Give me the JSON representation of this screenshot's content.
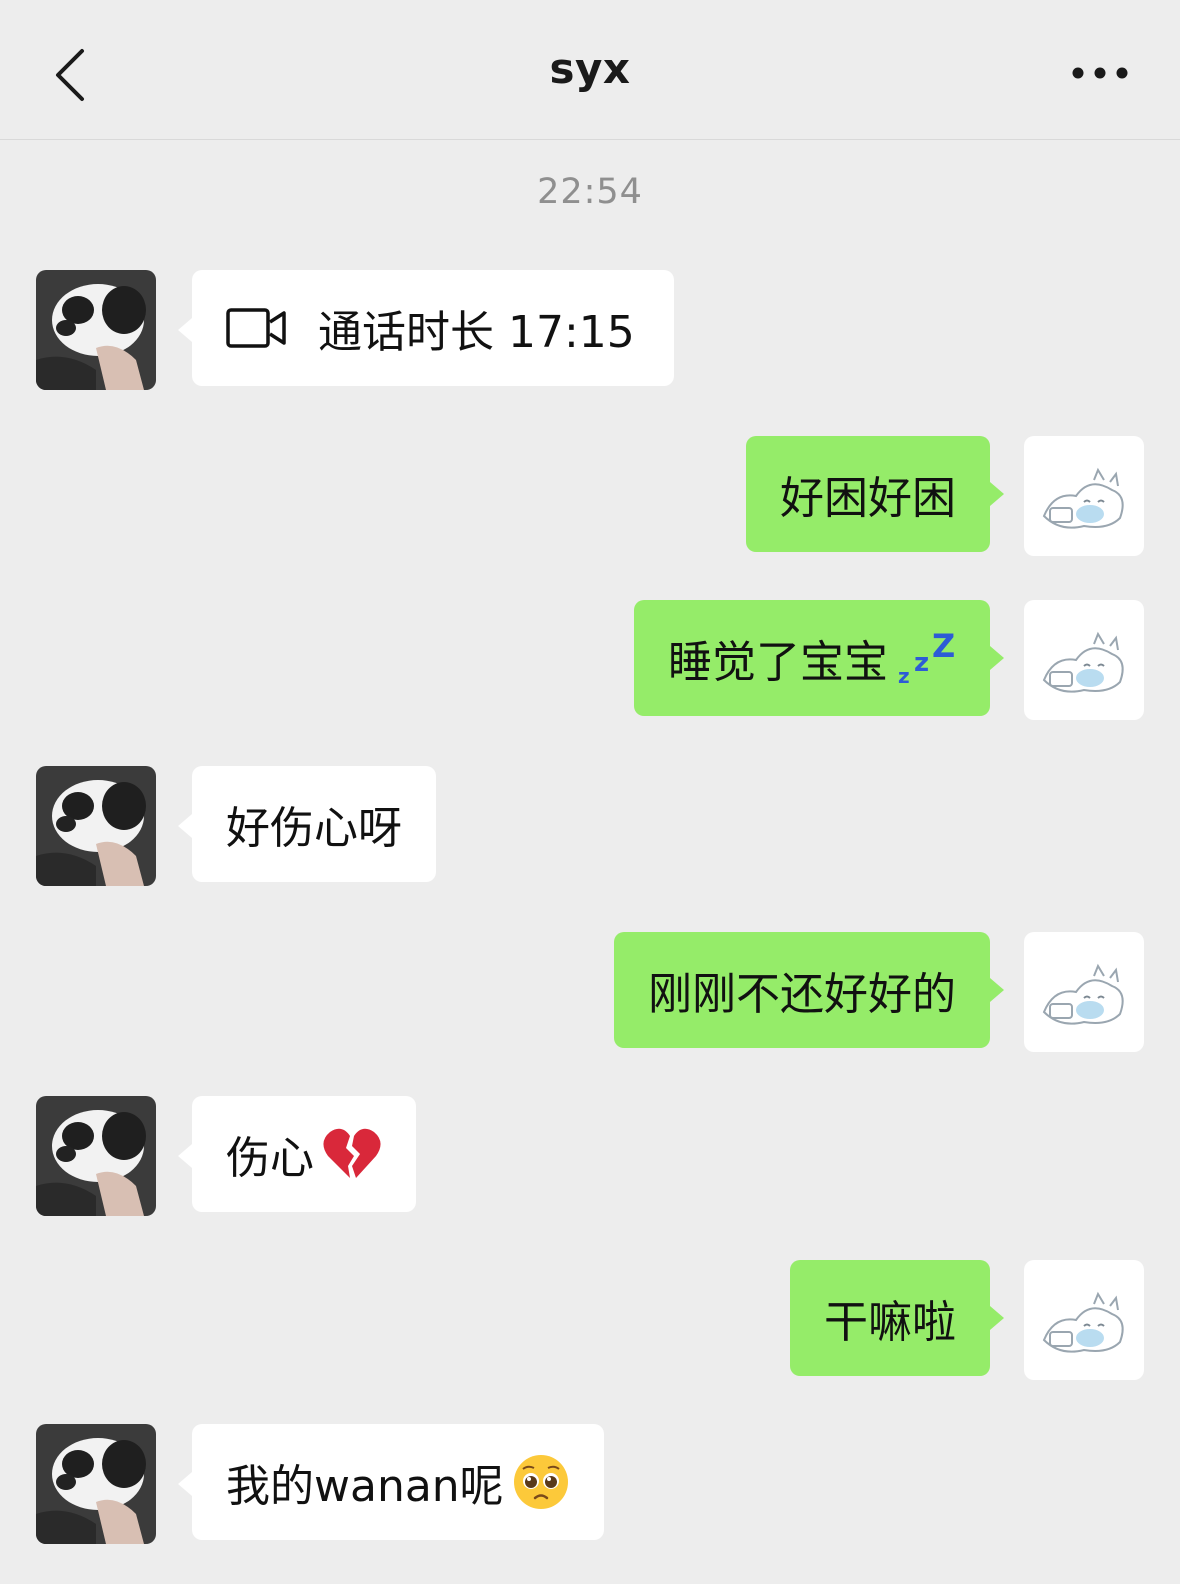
{
  "header": {
    "title": "syx"
  },
  "timestamp": "22:54",
  "messages": [
    {
      "side": "in",
      "kind": "call",
      "text": "通话时长 17:15"
    },
    {
      "side": "out",
      "text": "好困好困"
    },
    {
      "side": "out",
      "text": "睡觉了宝宝",
      "emoji": "zzz"
    },
    {
      "side": "in",
      "text": "好伤心呀"
    },
    {
      "side": "out",
      "text": "刚刚不还好好的"
    },
    {
      "side": "in",
      "text": "伤心",
      "emoji": "broken-heart"
    },
    {
      "side": "out",
      "text": "干嘛啦"
    },
    {
      "side": "in",
      "text": "我的wanan呢",
      "emoji": "pleading-face"
    }
  ],
  "colors": {
    "background": "#ededed",
    "outgoing_bubble": "#95ec69",
    "incoming_bubble": "#ffffff"
  }
}
